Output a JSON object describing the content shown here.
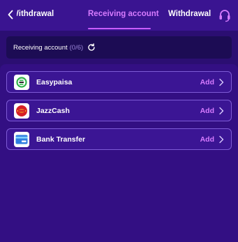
{
  "header": {
    "tabs": [
      {
        "label": "Withdrawal"
      },
      {
        "label": "Receiving account",
        "active": true
      },
      {
        "label": "Withdrawal history"
      }
    ],
    "back_icon": "chevron-left-icon",
    "support_icon": "headset-icon"
  },
  "summary": {
    "label": "Receiving account",
    "count": "(0/6)",
    "refresh_icon": "refresh-icon"
  },
  "accounts": [
    {
      "label": "Easypaisa",
      "action": "Add",
      "icon": "easypaisa-logo-icon"
    },
    {
      "label": "JazzCash",
      "action": "Add",
      "icon": "jazzcash-logo-icon"
    },
    {
      "label": "Bank Transfer",
      "action": "Add",
      "icon": "bank-card-icon"
    }
  ],
  "colors": {
    "background": "#2b0e72",
    "header": "#3a1491",
    "accent": "#d77bff",
    "row_border": "#7e5bd6"
  }
}
